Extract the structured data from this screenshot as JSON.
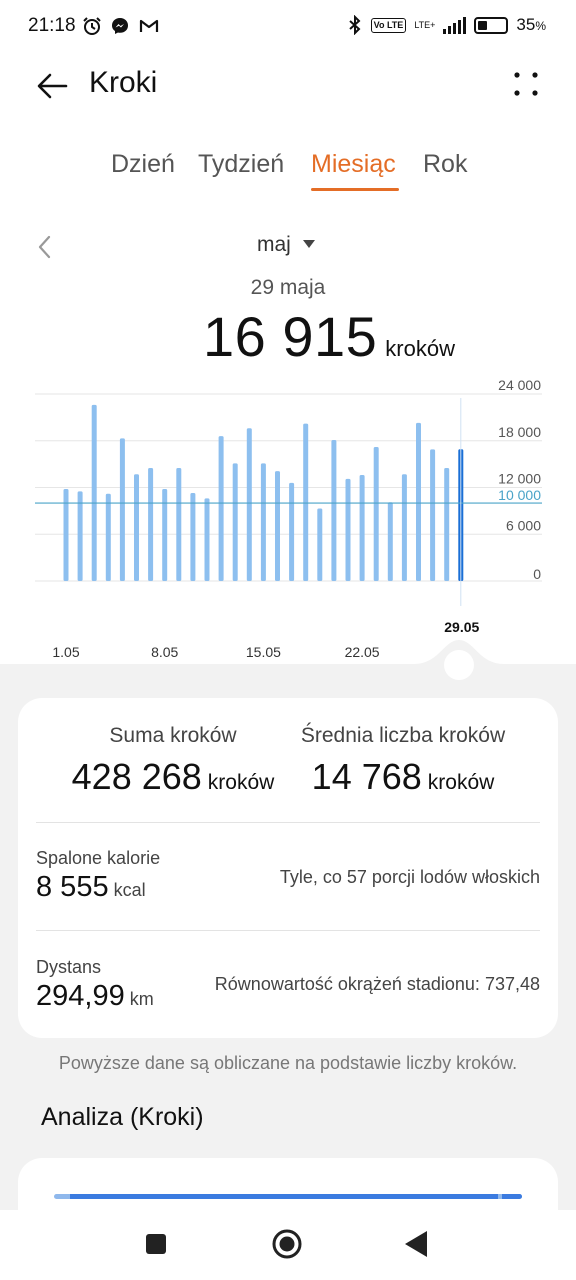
{
  "status_bar": {
    "time": "21:18",
    "lte_label": "LTE+",
    "volte_label": "Vo LTE",
    "battery_percent": "35",
    "battery_suffix": "%",
    "battery_level": 0.35,
    "left_icons": [
      "alarm-icon",
      "messenger-icon",
      "gmail-icon"
    ],
    "right_icons": [
      "bluetooth-icon",
      "volte-icon",
      "signal-icon",
      "battery-icon"
    ]
  },
  "header": {
    "title": "Kroki",
    "back_icon": "arrow-left-icon",
    "more_icon": "more-dots-icon"
  },
  "tabs": [
    {
      "label": "Dzień",
      "active": false
    },
    {
      "label": "Tydzień",
      "active": false
    },
    {
      "label": "Miesiąc",
      "active": true
    },
    {
      "label": "Rok",
      "active": false
    }
  ],
  "period": {
    "month": "maj",
    "selected_date": "29 maja",
    "selected_value": "16 915",
    "selected_unit": "kroków"
  },
  "chart_data": {
    "type": "bar",
    "categories": [
      "1.05",
      "2.05",
      "3.05",
      "4.05",
      "5.05",
      "6.05",
      "7.05",
      "8.05",
      "9.05",
      "10.05",
      "11.05",
      "12.05",
      "13.05",
      "14.05",
      "15.05",
      "16.05",
      "17.05",
      "18.05",
      "19.05",
      "20.05",
      "21.05",
      "22.05",
      "23.05",
      "24.05",
      "25.05",
      "26.05",
      "27.05",
      "28.05",
      "29.05"
    ],
    "x_tick_labels": [
      "1.05",
      "8.05",
      "15.05",
      "22.05"
    ],
    "selected_label": "29.05",
    "values": [
      11800,
      11500,
      22600,
      11200,
      18300,
      13700,
      14500,
      11800,
      14500,
      11300,
      10600,
      18600,
      15100,
      19600,
      15100,
      14100,
      12600,
      20200,
      9300,
      18100,
      13100,
      13600,
      17200,
      10100,
      13700,
      20300,
      16900,
      14500,
      16915
    ],
    "ylim": [
      0,
      24000
    ],
    "y_tick_labels": [
      "24 000",
      "18 000",
      "12 000",
      "6 000",
      "0"
    ],
    "y_ticks": [
      24000,
      18000,
      12000,
      6000,
      0
    ],
    "goal_value": 10000,
    "goal_label": "10 000",
    "selected_index": 28,
    "bar_color": "#8dbfef",
    "selected_bar_color": "#1a6fd6",
    "goal_color": "#4aa3c8"
  },
  "summary": {
    "total_label": "Suma kroków",
    "total_value": "428 268",
    "total_unit": "kroków",
    "average_label": "Średnia liczba kroków",
    "average_value": "14 768",
    "average_unit": "kroków",
    "calories_label": "Spalone kalorie",
    "calories_value": "8 555",
    "calories_unit": "kcal",
    "calories_note": "Tyle, co 57 porcji lodów włoskich",
    "distance_label": "Dystans",
    "distance_value": "294,99",
    "distance_unit": "km",
    "distance_note": "Równowartość okrążeń stadionu: 737,48"
  },
  "footnote": "Powyższe dane są obliczane na podstawie liczby kroków.",
  "analysis": {
    "title": "Analiza (Kroki)"
  },
  "navbar": {
    "icons": [
      "recents-square-icon",
      "home-circle-icon",
      "back-triangle-icon"
    ]
  },
  "colors": {
    "accent": "#e46d26",
    "bar": "#8dbfef",
    "bar_selected": "#1a6fd6",
    "background": "#f2f2f2"
  }
}
